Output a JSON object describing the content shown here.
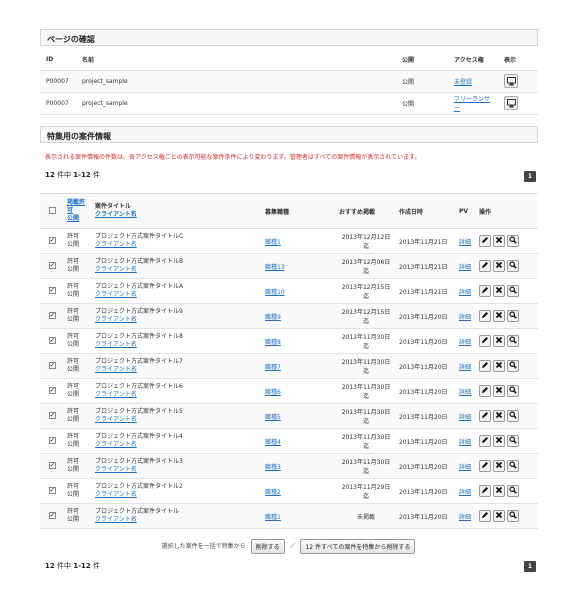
{
  "page_section": {
    "title": "ページの確認",
    "headers": [
      "ID",
      "名前",
      "公開",
      "アクセス権",
      "表示"
    ],
    "rows": [
      {
        "id": "P00007",
        "name": "project_sample",
        "public": "公開",
        "access": "未登録"
      },
      {
        "id": "P00007",
        "name": "project_sample",
        "public": "公開",
        "access": "フリーランサー"
      }
    ]
  },
  "feature_section": {
    "title": "特集用の案件情報",
    "notice": "表示される案件情報の件数は、各アクセス権ごとの表示可能な案件条件により変わります。管理者はすべての案件情報が表示されています。",
    "count_total": "12",
    "count_unit": " 件中 ",
    "count_range": "1-12",
    "count_suffix": " 件",
    "page": "1"
  },
  "listing": {
    "headers": {
      "status_top": "掲載許可",
      "status_bottom": "公開",
      "title": "案件タイトル",
      "client": "クライアント名",
      "recruit": "募集職種",
      "recommend": "おすすめ掲載",
      "created": "作成日時",
      "pv": "PV",
      "action": "操作"
    },
    "rows": [
      {
        "perm": "許可",
        "pub": "公開",
        "title": "プロジェクト方式案件タイトルC",
        "client": "クライアント名",
        "job": "職種1",
        "rec": "2013年12月12日迄",
        "created": "2013年11月21日",
        "pv": "詳細"
      },
      {
        "perm": "許可",
        "pub": "公開",
        "title": "プロジェクト方式案件タイトルB",
        "client": "クライアント名",
        "job": "職種13",
        "rec": "2013年12月06日迄",
        "created": "2013年11月21日",
        "pv": "詳細"
      },
      {
        "perm": "許可",
        "pub": "公開",
        "title": "プロジェクト方式案件タイトルA",
        "client": "クライアント名",
        "job": "職種10",
        "rec": "2013年12月15日迄",
        "created": "2013年11月21日",
        "pv": "詳細"
      },
      {
        "perm": "許可",
        "pub": "公開",
        "title": "プロジェクト方式案件タイトル9",
        "client": "クライアント名",
        "job": "職種9",
        "rec": "2013年12月15日迄",
        "created": "2013年11月20日",
        "pv": "詳細"
      },
      {
        "perm": "許可",
        "pub": "公開",
        "title": "プロジェクト方式案件タイトル8",
        "client": "クライアント名",
        "job": "職種8",
        "rec": "2013年11月30日迄",
        "created": "2013年11月20日",
        "pv": "詳細"
      },
      {
        "perm": "許可",
        "pub": "公開",
        "title": "プロジェクト方式案件タイトル7",
        "client": "クライアント名",
        "job": "職種7",
        "rec": "2013年11月30日迄",
        "created": "2013年11月20日",
        "pv": "詳細"
      },
      {
        "perm": "許可",
        "pub": "公開",
        "title": "プロジェクト方式案件タイトル6",
        "client": "クライアント名",
        "job": "職種6",
        "rec": "2013年11月30日迄",
        "created": "2013年11月20日",
        "pv": "詳細"
      },
      {
        "perm": "許可",
        "pub": "公開",
        "title": "プロジェクト方式案件タイトル5",
        "client": "クライアント名",
        "job": "職種5",
        "rec": "2013年11月30日迄",
        "created": "2013年11月20日",
        "pv": "詳細"
      },
      {
        "perm": "許可",
        "pub": "公開",
        "title": "プロジェクト方式案件タイトル4",
        "client": "クライアント名",
        "job": "職種4",
        "rec": "2013年11月30日迄",
        "created": "2013年11月20日",
        "pv": "詳細"
      },
      {
        "perm": "許可",
        "pub": "公開",
        "title": "プロジェクト方式案件タイトル3",
        "client": "クライアント名",
        "job": "職種3",
        "rec": "2013年11月30日迄",
        "created": "2013年11月20日",
        "pv": "詳細"
      },
      {
        "perm": "許可",
        "pub": "公開",
        "title": "プロジェクト方式案件タイトル2",
        "client": "クライアント名",
        "job": "職種2",
        "rec": "2013年11月29日迄",
        "created": "2013年11月20日",
        "pv": "詳細"
      },
      {
        "perm": "許可",
        "pub": "公開",
        "title": "プロジェクト方式案件タイトル",
        "client": "クライアント名",
        "job": "職種1",
        "rec": "未掲載",
        "created": "2013年11月20日",
        "pv": "詳細"
      }
    ]
  },
  "bulk": {
    "prefix": "選択した案件を一括で特集から",
    "delete_label": "削除する",
    "separator": "／",
    "delete_all_label": "12 件すべての案件を特集から削除する"
  },
  "icons": {
    "view": "monitor-icon",
    "edit": "pencil-icon",
    "delete": "close-icon",
    "preview": "search-icon"
  },
  "colors": {
    "link": "#1a73c9",
    "notice": "#d12a2a"
  }
}
